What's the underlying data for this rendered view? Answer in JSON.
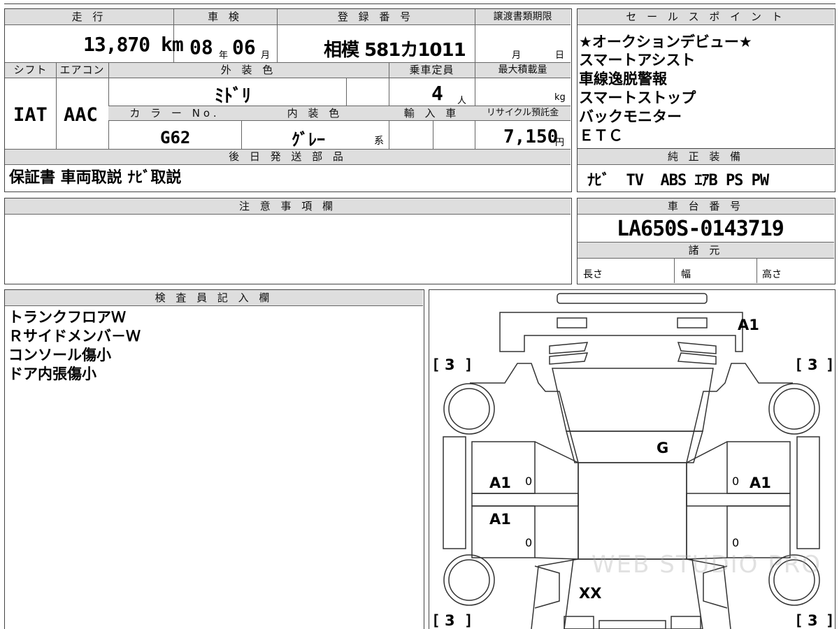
{
  "top_info": {
    "headers": {
      "mileage": "走 行",
      "inspection": "車 検",
      "registration": "登 録 番 号",
      "transfer_deadline": "譲渡書類期限",
      "shift": "シフト",
      "aircon": "エアコン",
      "exterior_color": "外 装 色",
      "capacity": "乗車定員",
      "max_load": "最大積載量",
      "color_no": "カ ラ ー No.",
      "interior_color": "内 装 色",
      "import": "輸 入 車",
      "recycle_fee": "リサイクル預託金",
      "later_parts": "後 日 発 送 部 品"
    },
    "mileage": "13,870 km",
    "inspection_year": "08",
    "inspection_year_unit": "年",
    "inspection_month": "06",
    "inspection_month_unit": "月",
    "registration_number": "相模 581カ1011",
    "transfer_month_unit": "月",
    "transfer_day_unit": "日",
    "shift": "IAT",
    "aircon": "AAC",
    "exterior_color": "ﾐﾄﾞﾘ",
    "capacity": "4",
    "capacity_unit": "人",
    "max_load_unit": "kg",
    "color_no": "G62",
    "interior_color": "ｸﾞﾚｰ",
    "interior_suffix": "系",
    "recycle_fee": "7,150",
    "recycle_unit": "円",
    "later_parts": "保証書 車両取説 ﾅﾋﾞ取説"
  },
  "sales_points": {
    "header": "セ ー ル ス ポ イ ン ト",
    "lines": [
      "★オークションデビュー★",
      "スマートアシスト",
      "車線逸脱警報",
      "スマートストップ",
      "バックモニター",
      "ＥＴＣ"
    ]
  },
  "genuine_equipment": {
    "header": "純 正 装 備",
    "text": "ﾅﾋﾞ  TV  ABS ｴｱB PS PW"
  },
  "notes": {
    "header": "注 意 事 項 欄"
  },
  "chassis": {
    "header": "車 台 番 号",
    "number": "LA650S-0143719",
    "spec_header": "諸 元",
    "length": "長さ",
    "width": "幅",
    "height": "高さ"
  },
  "inspector": {
    "header": "検 査 員 記 入 欄",
    "lines": [
      "トランクフロアＷ",
      "Ｒサイドメンバ－Ｗ",
      "コンソール傷小",
      "ドア内張傷小"
    ]
  },
  "car_diagram": {
    "marks": {
      "rear_bumper": "A1",
      "front_glass": "G",
      "left_front_door": "A1",
      "right_front_door": "A1",
      "left_rear_door": "A1",
      "hood": "XX",
      "zero": "0"
    },
    "tire_rating": "3",
    "bracket_left": "[",
    "bracket_right": "]",
    "watermark": "WEB STUDIO PRO"
  }
}
